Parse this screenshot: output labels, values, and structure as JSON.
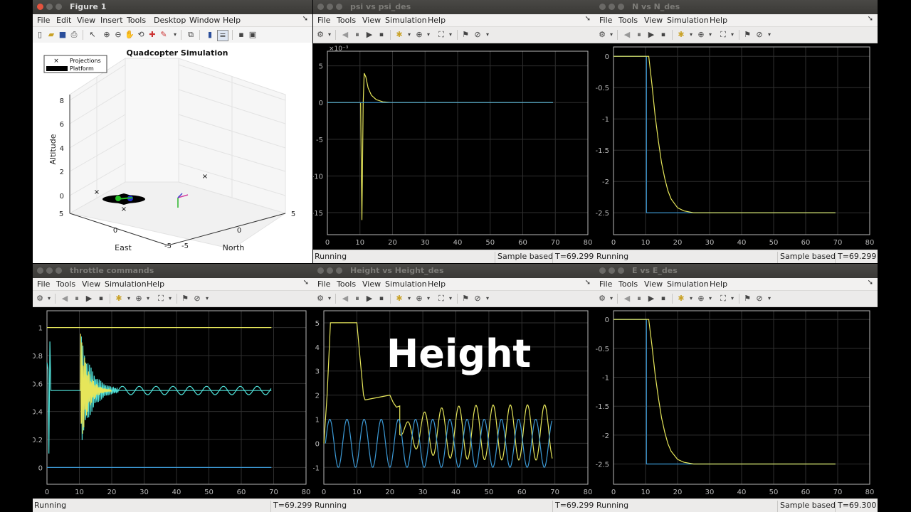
{
  "figure": {
    "title": "Figure 1",
    "menu": [
      "File",
      "Edit",
      "View",
      "Insert",
      "Tools",
      "Desktop",
      "Window",
      "Help"
    ],
    "plot_title": "Quadcopter Simulation",
    "legend": [
      "Projections",
      "Platform"
    ],
    "zlabel": "Altitude",
    "xlabel": "East",
    "ylabel": "North",
    "z_ticks": [
      "8",
      "6",
      "4",
      "2",
      "0"
    ],
    "east_ticks": [
      "5",
      "0",
      "-5"
    ],
    "north_ticks": [
      "-5",
      "0",
      "5"
    ]
  },
  "scopes": {
    "menu": [
      "File",
      "Tools",
      "View",
      "Simulation",
      "Help"
    ],
    "psi": {
      "title": "psi vs psi_des",
      "exponent": "×10⁻³",
      "status": "Running",
      "sample": "Sample based",
      "time": "T=69.299"
    },
    "north": {
      "title": "N vs N_des",
      "status": "Running",
      "sample": "Sample based",
      "time": "T=69.299"
    },
    "throttle": {
      "title": "throttle commands",
      "status": "Running",
      "time": "T=69.299"
    },
    "height": {
      "title": "Height vs Height_des",
      "status": "Running",
      "time": "T=69.299",
      "overlay": "Height"
    },
    "east": {
      "title": "E vs E_des",
      "status": "Running",
      "sample": "Sample based",
      "time": "T=69.300"
    }
  },
  "colors": {
    "yellow": "#e6e65a",
    "blue": "#3c9ad6",
    "cyan": "#4fe0d8",
    "grid": "#2f2f2f",
    "axis": "#b9b9b9"
  },
  "chart_data": [
    {
      "type": "line",
      "name": "psi vs psi_des",
      "xlim": [
        0,
        80
      ],
      "ylim": [
        -18,
        7
      ],
      "x_ticks": [
        0,
        10,
        20,
        30,
        40,
        50,
        60,
        70,
        80
      ],
      "y_ticks": [
        5,
        0,
        -5,
        -10,
        -15
      ],
      "series": [
        {
          "color": "yellow",
          "x": [
            0,
            10.2,
            10.6,
            11.0,
            11.3,
            11.8,
            12.5,
            13.5,
            15,
            17,
            20,
            25,
            69.3
          ],
          "y": [
            0,
            0,
            -16,
            0,
            4,
            3.5,
            2,
            1,
            0.4,
            0.1,
            0,
            0,
            0
          ]
        },
        {
          "color": "blue",
          "x": [
            0,
            69.3
          ],
          "y": [
            0,
            0
          ]
        }
      ]
    },
    {
      "type": "line",
      "name": "N vs N_des",
      "xlim": [
        0,
        80
      ],
      "ylim": [
        -2.85,
        0.15
      ],
      "x_ticks": [
        0,
        10,
        20,
        30,
        40,
        50,
        60,
        70,
        80
      ],
      "y_ticks": [
        0,
        -0.5,
        -1,
        -1.5,
        -2,
        -2.5
      ],
      "series": [
        {
          "color": "blue",
          "x": [
            0,
            10.3,
            10.3,
            69.3
          ],
          "y": [
            0,
            0,
            -2.5,
            -2.5
          ]
        },
        {
          "color": "yellow",
          "x": [
            0,
            11,
            12,
            13,
            14,
            15,
            16,
            17,
            18,
            20,
            22,
            25,
            30,
            69.3
          ],
          "y": [
            0,
            0,
            -0.45,
            -0.95,
            -1.35,
            -1.7,
            -1.95,
            -2.15,
            -2.28,
            -2.42,
            -2.47,
            -2.5,
            -2.5,
            -2.5
          ]
        }
      ]
    },
    {
      "type": "line",
      "name": "throttle commands",
      "xlim": [
        0,
        80
      ],
      "ylim": [
        -0.12,
        1.12
      ],
      "x_ticks": [
        0,
        10,
        20,
        30,
        40,
        50,
        60,
        70,
        80
      ],
      "y_ticks": [
        1,
        0.8,
        0.6,
        0.4,
        0.2,
        0
      ],
      "series": [
        {
          "color": "yellow",
          "x": [
            0,
            69.3
          ],
          "y": [
            1,
            1
          ]
        },
        {
          "color": "blue",
          "x": [
            0,
            69.3
          ],
          "y": [
            0,
            0
          ]
        },
        {
          "color": "cyan",
          "x": [
            0,
            0.3,
            0.6,
            0.9,
            1.2,
            10,
            69.3
          ],
          "y": [
            0.75,
            0.7,
            0.1,
            0.9,
            0.55,
            0.55,
            0.55
          ]
        }
      ]
    },
    {
      "type": "line",
      "name": "Height vs Height_des",
      "xlim": [
        0,
        80
      ],
      "ylim": [
        -1.7,
        5.5
      ],
      "x_ticks": [
        0,
        10,
        20,
        30,
        40,
        50,
        60,
        70,
        80
      ],
      "y_ticks": [
        5,
        4,
        3,
        2,
        1,
        0,
        -1
      ],
      "series": [
        {
          "color": "yellow",
          "x": [
            0,
            1,
            2,
            10,
            11,
            12,
            12.5,
            20,
            21,
            22,
            23,
            69.3
          ],
          "y": [
            0,
            2,
            5,
            5,
            3.5,
            2,
            1.8,
            2,
            1.7,
            1.5,
            1.55,
            0.5
          ]
        },
        {
          "color": "blue",
          "x": [
            0,
            69.3
          ],
          "y": [
            0,
            0
          ]
        }
      ]
    },
    {
      "type": "line",
      "name": "E vs E_des",
      "xlim": [
        0,
        80
      ],
      "ylim": [
        -2.85,
        0.15
      ],
      "x_ticks": [
        0,
        10,
        20,
        30,
        40,
        50,
        60,
        70,
        80
      ],
      "y_ticks": [
        0,
        -0.5,
        -1,
        -1.5,
        -2,
        -2.5
      ],
      "series": [
        {
          "color": "blue",
          "x": [
            0,
            10.3,
            10.3,
            69.3
          ],
          "y": [
            0,
            0,
            -2.5,
            -2.5
          ]
        },
        {
          "color": "yellow",
          "x": [
            0,
            11,
            12,
            13,
            14,
            15,
            16,
            17,
            18,
            20,
            22,
            25,
            30,
            69.3
          ],
          "y": [
            0,
            0,
            -0.45,
            -0.95,
            -1.35,
            -1.7,
            -1.95,
            -2.15,
            -2.28,
            -2.42,
            -2.47,
            -2.5,
            -2.5,
            -2.5
          ]
        }
      ]
    }
  ]
}
